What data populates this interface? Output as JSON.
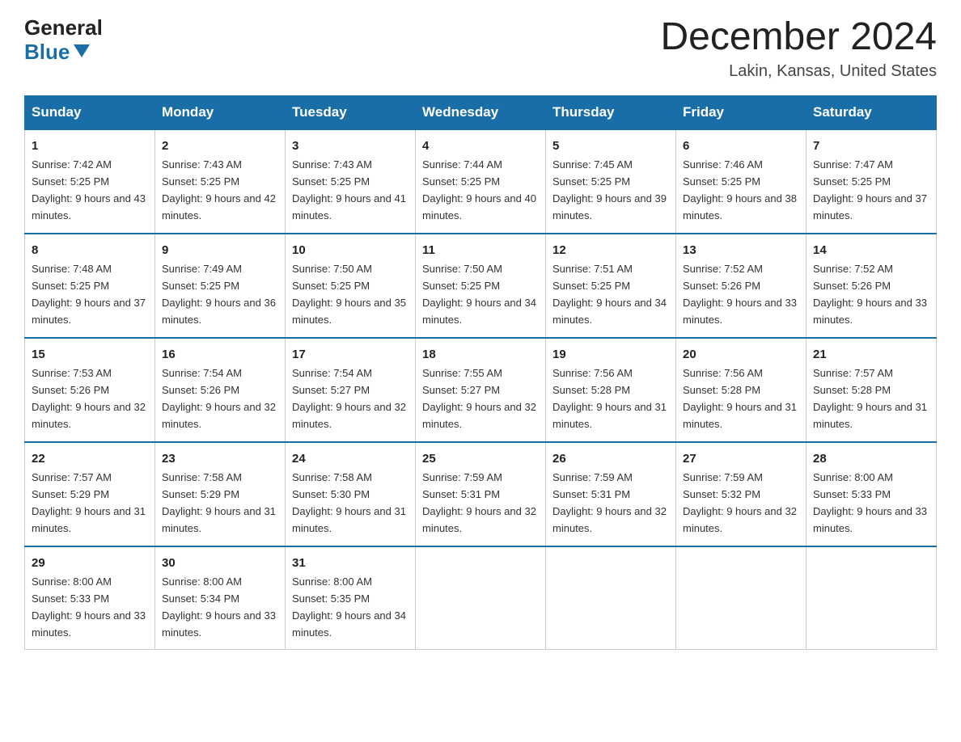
{
  "header": {
    "logo_general": "General",
    "logo_blue": "Blue",
    "month_title": "December 2024",
    "location": "Lakin, Kansas, United States"
  },
  "days_of_week": [
    "Sunday",
    "Monday",
    "Tuesday",
    "Wednesday",
    "Thursday",
    "Friday",
    "Saturday"
  ],
  "weeks": [
    [
      {
        "day": "1",
        "sunrise": "7:42 AM",
        "sunset": "5:25 PM",
        "daylight": "9 hours and 43 minutes."
      },
      {
        "day": "2",
        "sunrise": "7:43 AM",
        "sunset": "5:25 PM",
        "daylight": "9 hours and 42 minutes."
      },
      {
        "day": "3",
        "sunrise": "7:43 AM",
        "sunset": "5:25 PM",
        "daylight": "9 hours and 41 minutes."
      },
      {
        "day": "4",
        "sunrise": "7:44 AM",
        "sunset": "5:25 PM",
        "daylight": "9 hours and 40 minutes."
      },
      {
        "day": "5",
        "sunrise": "7:45 AM",
        "sunset": "5:25 PM",
        "daylight": "9 hours and 39 minutes."
      },
      {
        "day": "6",
        "sunrise": "7:46 AM",
        "sunset": "5:25 PM",
        "daylight": "9 hours and 38 minutes."
      },
      {
        "day": "7",
        "sunrise": "7:47 AM",
        "sunset": "5:25 PM",
        "daylight": "9 hours and 37 minutes."
      }
    ],
    [
      {
        "day": "8",
        "sunrise": "7:48 AM",
        "sunset": "5:25 PM",
        "daylight": "9 hours and 37 minutes."
      },
      {
        "day": "9",
        "sunrise": "7:49 AM",
        "sunset": "5:25 PM",
        "daylight": "9 hours and 36 minutes."
      },
      {
        "day": "10",
        "sunrise": "7:50 AM",
        "sunset": "5:25 PM",
        "daylight": "9 hours and 35 minutes."
      },
      {
        "day": "11",
        "sunrise": "7:50 AM",
        "sunset": "5:25 PM",
        "daylight": "9 hours and 34 minutes."
      },
      {
        "day": "12",
        "sunrise": "7:51 AM",
        "sunset": "5:25 PM",
        "daylight": "9 hours and 34 minutes."
      },
      {
        "day": "13",
        "sunrise": "7:52 AM",
        "sunset": "5:26 PM",
        "daylight": "9 hours and 33 minutes."
      },
      {
        "day": "14",
        "sunrise": "7:52 AM",
        "sunset": "5:26 PM",
        "daylight": "9 hours and 33 minutes."
      }
    ],
    [
      {
        "day": "15",
        "sunrise": "7:53 AM",
        "sunset": "5:26 PM",
        "daylight": "9 hours and 32 minutes."
      },
      {
        "day": "16",
        "sunrise": "7:54 AM",
        "sunset": "5:26 PM",
        "daylight": "9 hours and 32 minutes."
      },
      {
        "day": "17",
        "sunrise": "7:54 AM",
        "sunset": "5:27 PM",
        "daylight": "9 hours and 32 minutes."
      },
      {
        "day": "18",
        "sunrise": "7:55 AM",
        "sunset": "5:27 PM",
        "daylight": "9 hours and 32 minutes."
      },
      {
        "day": "19",
        "sunrise": "7:56 AM",
        "sunset": "5:28 PM",
        "daylight": "9 hours and 31 minutes."
      },
      {
        "day": "20",
        "sunrise": "7:56 AM",
        "sunset": "5:28 PM",
        "daylight": "9 hours and 31 minutes."
      },
      {
        "day": "21",
        "sunrise": "7:57 AM",
        "sunset": "5:28 PM",
        "daylight": "9 hours and 31 minutes."
      }
    ],
    [
      {
        "day": "22",
        "sunrise": "7:57 AM",
        "sunset": "5:29 PM",
        "daylight": "9 hours and 31 minutes."
      },
      {
        "day": "23",
        "sunrise": "7:58 AM",
        "sunset": "5:29 PM",
        "daylight": "9 hours and 31 minutes."
      },
      {
        "day": "24",
        "sunrise": "7:58 AM",
        "sunset": "5:30 PM",
        "daylight": "9 hours and 31 minutes."
      },
      {
        "day": "25",
        "sunrise": "7:59 AM",
        "sunset": "5:31 PM",
        "daylight": "9 hours and 32 minutes."
      },
      {
        "day": "26",
        "sunrise": "7:59 AM",
        "sunset": "5:31 PM",
        "daylight": "9 hours and 32 minutes."
      },
      {
        "day": "27",
        "sunrise": "7:59 AM",
        "sunset": "5:32 PM",
        "daylight": "9 hours and 32 minutes."
      },
      {
        "day": "28",
        "sunrise": "8:00 AM",
        "sunset": "5:33 PM",
        "daylight": "9 hours and 33 minutes."
      }
    ],
    [
      {
        "day": "29",
        "sunrise": "8:00 AM",
        "sunset": "5:33 PM",
        "daylight": "9 hours and 33 minutes."
      },
      {
        "day": "30",
        "sunrise": "8:00 AM",
        "sunset": "5:34 PM",
        "daylight": "9 hours and 33 minutes."
      },
      {
        "day": "31",
        "sunrise": "8:00 AM",
        "sunset": "5:35 PM",
        "daylight": "9 hours and 34 minutes."
      },
      null,
      null,
      null,
      null
    ]
  ]
}
